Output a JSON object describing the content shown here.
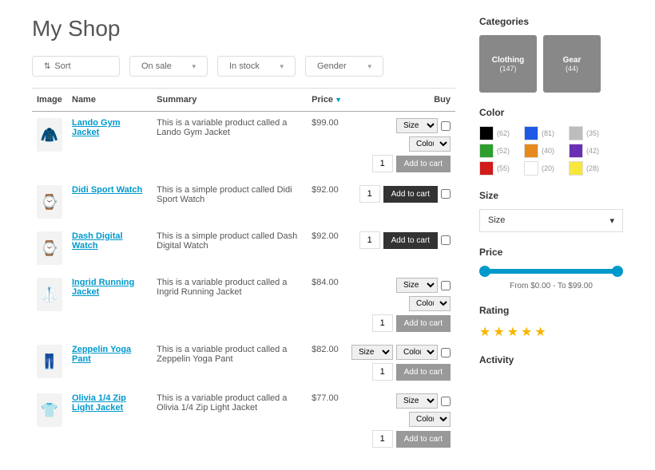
{
  "title": "My Shop",
  "filters": {
    "sort": "Sort",
    "sale": "On sale",
    "stock": "In stock",
    "gender": "Gender"
  },
  "columns": {
    "image": "Image",
    "name": "Name",
    "summary": "Summary",
    "price": "Price",
    "buy": "Buy"
  },
  "products": [
    {
      "name": "Lando Gym Jacket",
      "summary": "This is a variable product called a Lando Gym Jacket",
      "price": "$99.00",
      "variable": true,
      "stacked": true,
      "add": "Add to cart",
      "icon": "🧥"
    },
    {
      "name": "Didi Sport Watch",
      "summary": "This is a simple product called Didi Sport Watch",
      "price": "$92.00",
      "variable": false,
      "add": "Add to cart",
      "icon": "⌚"
    },
    {
      "name": "Dash Digital Watch",
      "summary": "This is a simple product called Dash Digital Watch",
      "price": "$92.00",
      "variable": false,
      "add": "Add to cart",
      "icon": "⌚"
    },
    {
      "name": "Ingrid Running Jacket",
      "summary": "This is a variable product called a Ingrid Running Jacket",
      "price": "$84.00",
      "variable": true,
      "stacked": true,
      "add": "Add to cart",
      "icon": "🥼"
    },
    {
      "name": "Zeppelin Yoga Pant",
      "summary": "This is a variable product called a Zeppelin Yoga Pant",
      "price": "$82.00",
      "variable": true,
      "stacked": false,
      "add": "Add to cart",
      "icon": "👖"
    },
    {
      "name": "Olivia 1/4 Zip Light Jacket",
      "summary": "This is a variable product called a Olivia 1/4 Zip Light Jacket",
      "price": "$77.00",
      "variable": true,
      "stacked": true,
      "add": "Add to cart",
      "icon": "👕"
    }
  ],
  "opt_size": "Size",
  "opt_color": "Color",
  "qty_default": "1",
  "sidebar": {
    "categories_h": "Categories",
    "categories": [
      {
        "name": "Clothing",
        "count": "(147)"
      },
      {
        "name": "Gear",
        "count": "(44)"
      }
    ],
    "color_h": "Color",
    "colors": [
      {
        "hex": "#000000",
        "count": "(62)"
      },
      {
        "hex": "#1e5ae6",
        "count": "(81)"
      },
      {
        "hex": "#bdbdbd",
        "count": "(35)"
      },
      {
        "hex": "#2e9e2e",
        "count": "(52)"
      },
      {
        "hex": "#e68a1e",
        "count": "(40)"
      },
      {
        "hex": "#6a2fb5",
        "count": "(42)"
      },
      {
        "hex": "#d11a1a",
        "count": "(55)"
      },
      {
        "hex": "#ffffff",
        "count": "(20)"
      },
      {
        "hex": "#f7e63c",
        "count": "(28)"
      }
    ],
    "size_h": "Size",
    "size_label": "Size",
    "price_h": "Price",
    "price_range": "From $0.00 - To $99.00",
    "rating_h": "Rating",
    "activity_h": "Activity"
  }
}
